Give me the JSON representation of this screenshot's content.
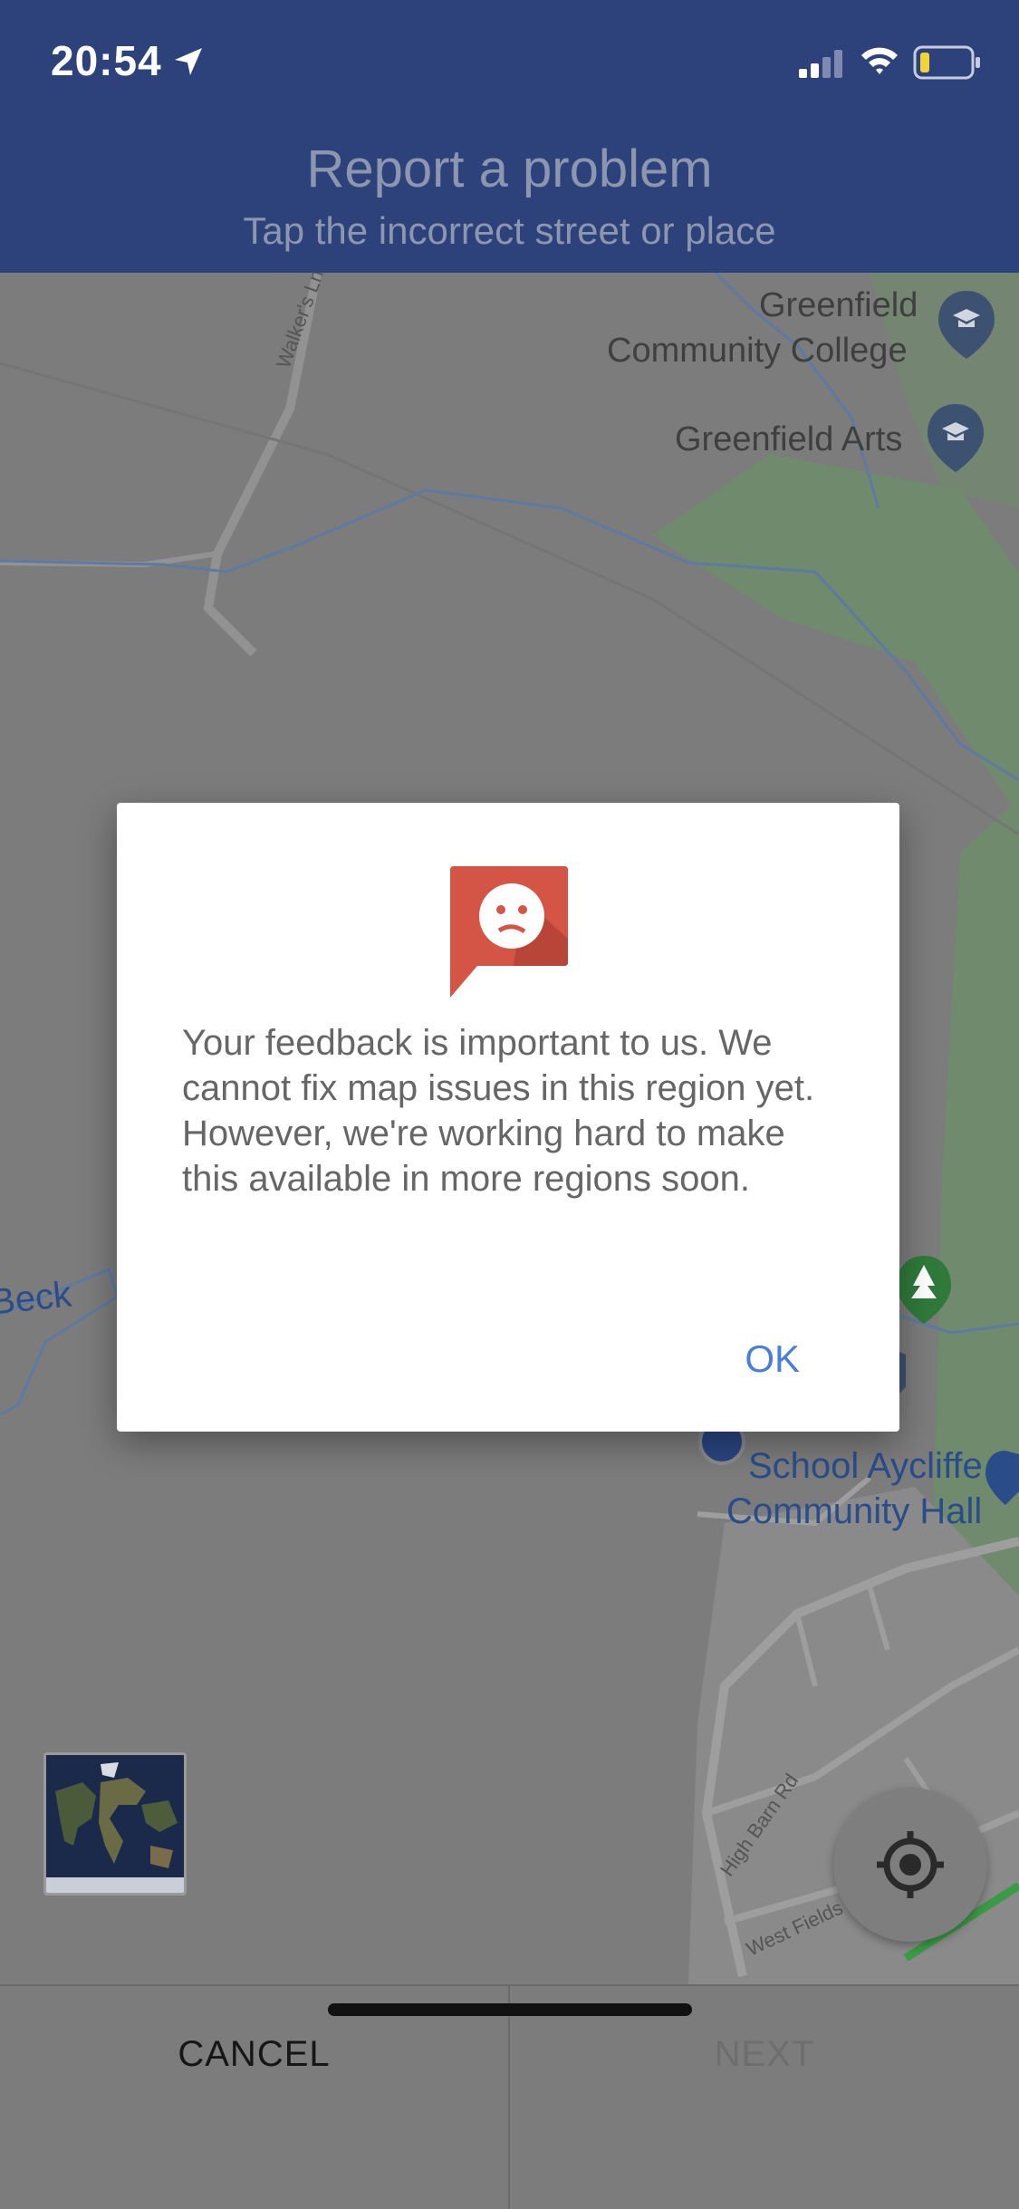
{
  "status_bar": {
    "time": "20:54"
  },
  "header": {
    "title": "Report a problem",
    "subtitle": "Tap the incorrect street or place"
  },
  "map": {
    "places": [
      {
        "line1": "Greenfield",
        "line2": "Community College",
        "icon": "school-icon"
      },
      {
        "line1": "Greenfield Arts",
        "icon": "school-icon"
      },
      {
        "line1": "School Aycliffe",
        "line2": "Community Hall"
      }
    ],
    "roads": [
      "Walker's Ln",
      "High Barn Rd",
      "West Fields"
    ],
    "water": "Beck"
  },
  "dialog": {
    "icon": "sad-feedback-icon",
    "message": "Your feedback is important to us. We cannot fix map issues in this region yet. However, we're working hard to make this available in more regions soon.",
    "ok_label": "OK"
  },
  "footer": {
    "cancel_label": "CANCEL",
    "next_label": "NEXT"
  }
}
